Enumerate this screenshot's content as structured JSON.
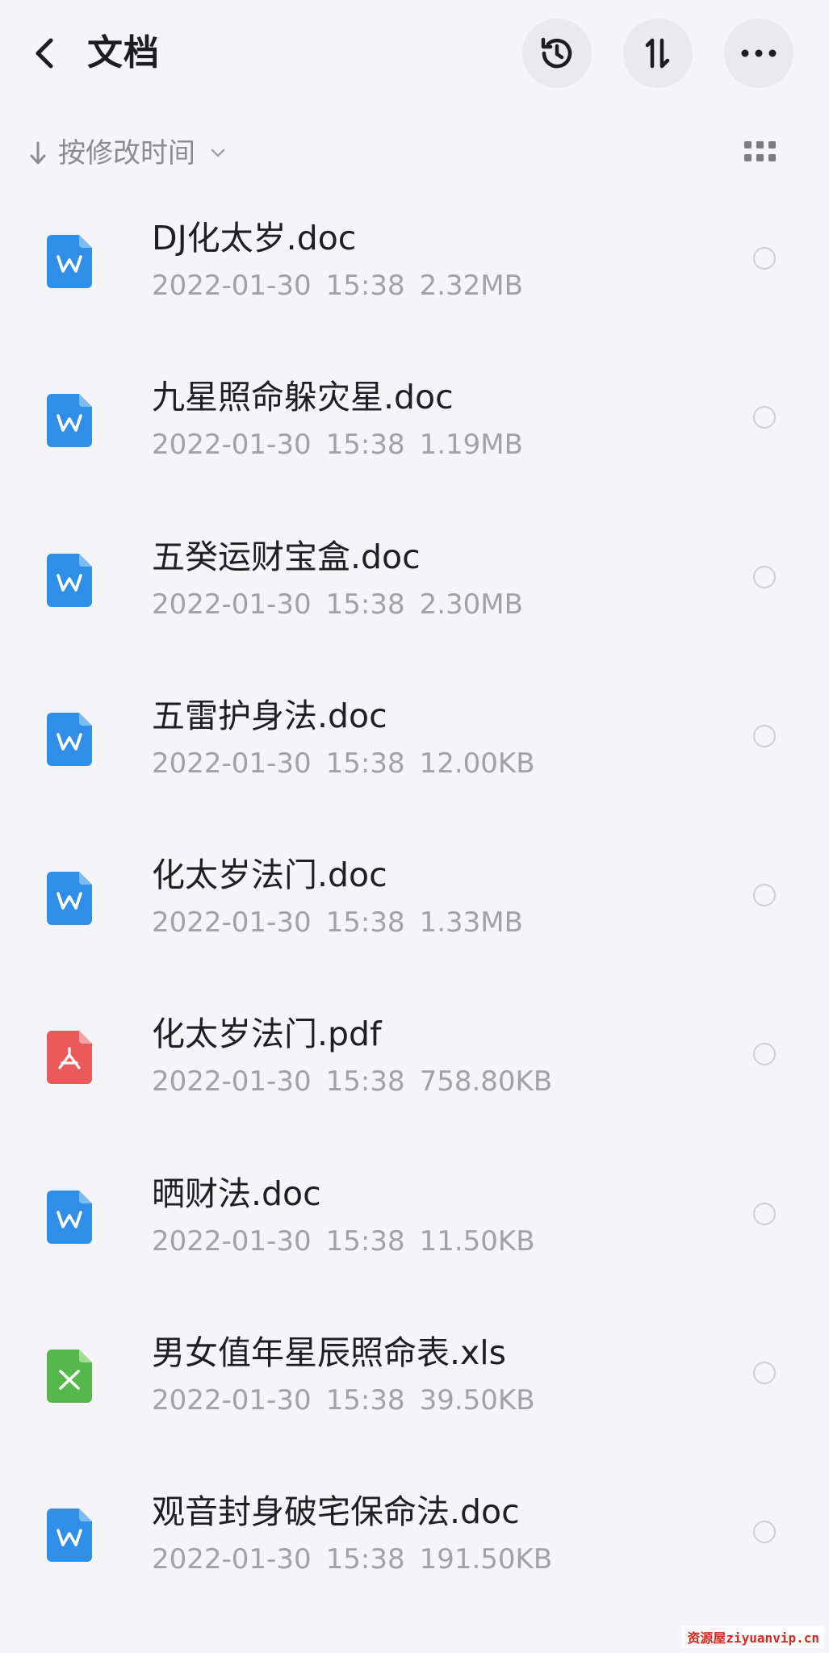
{
  "header": {
    "title": "文档",
    "back_icon": "chevron-left-icon",
    "actions": [
      {
        "name": "history",
        "icon": "history-clock-icon"
      },
      {
        "name": "sort",
        "icon": "sort-swap-icon"
      },
      {
        "name": "more",
        "icon": "more-horizontal-icon"
      }
    ]
  },
  "sort_bar": {
    "label": "按修改时间",
    "direction_icon": "arrow-down-icon",
    "dropdown_icon": "chevron-down-icon",
    "view_icon": "grid-view-icon"
  },
  "files": [
    {
      "name": "DJ化太岁.doc",
      "date": "2022-01-30",
      "time": "15:38",
      "size": "2.32MB",
      "type": "word"
    },
    {
      "name": "九星照命躲灾星.doc",
      "date": "2022-01-30",
      "time": "15:38",
      "size": "1.19MB",
      "type": "word"
    },
    {
      "name": "五癸运财宝盒.doc",
      "date": "2022-01-30",
      "time": "15:38",
      "size": "2.30MB",
      "type": "word"
    },
    {
      "name": "五雷护身法.doc",
      "date": "2022-01-30",
      "time": "15:38",
      "size": "12.00KB",
      "type": "word"
    },
    {
      "name": "化太岁法门.doc",
      "date": "2022-01-30",
      "time": "15:38",
      "size": "1.33MB",
      "type": "word"
    },
    {
      "name": "化太岁法门.pdf",
      "date": "2022-01-30",
      "time": "15:38",
      "size": "758.80KB",
      "type": "pdf"
    },
    {
      "name": "晒财法.doc",
      "date": "2022-01-30",
      "time": "15:38",
      "size": "11.50KB",
      "type": "word"
    },
    {
      "name": "男女值年星辰照命表.xls",
      "date": "2022-01-30",
      "time": "15:38",
      "size": "39.50KB",
      "type": "excel"
    },
    {
      "name": "观音封身破宅保命法.doc",
      "date": "2022-01-30",
      "time": "15:38",
      "size": "191.50KB",
      "type": "word"
    }
  ],
  "file_type_colors": {
    "word": "#2f8fe8",
    "pdf": "#eb5a5a",
    "excel": "#56b84a"
  },
  "watermark": "资源屋ziyuanvip.cn"
}
